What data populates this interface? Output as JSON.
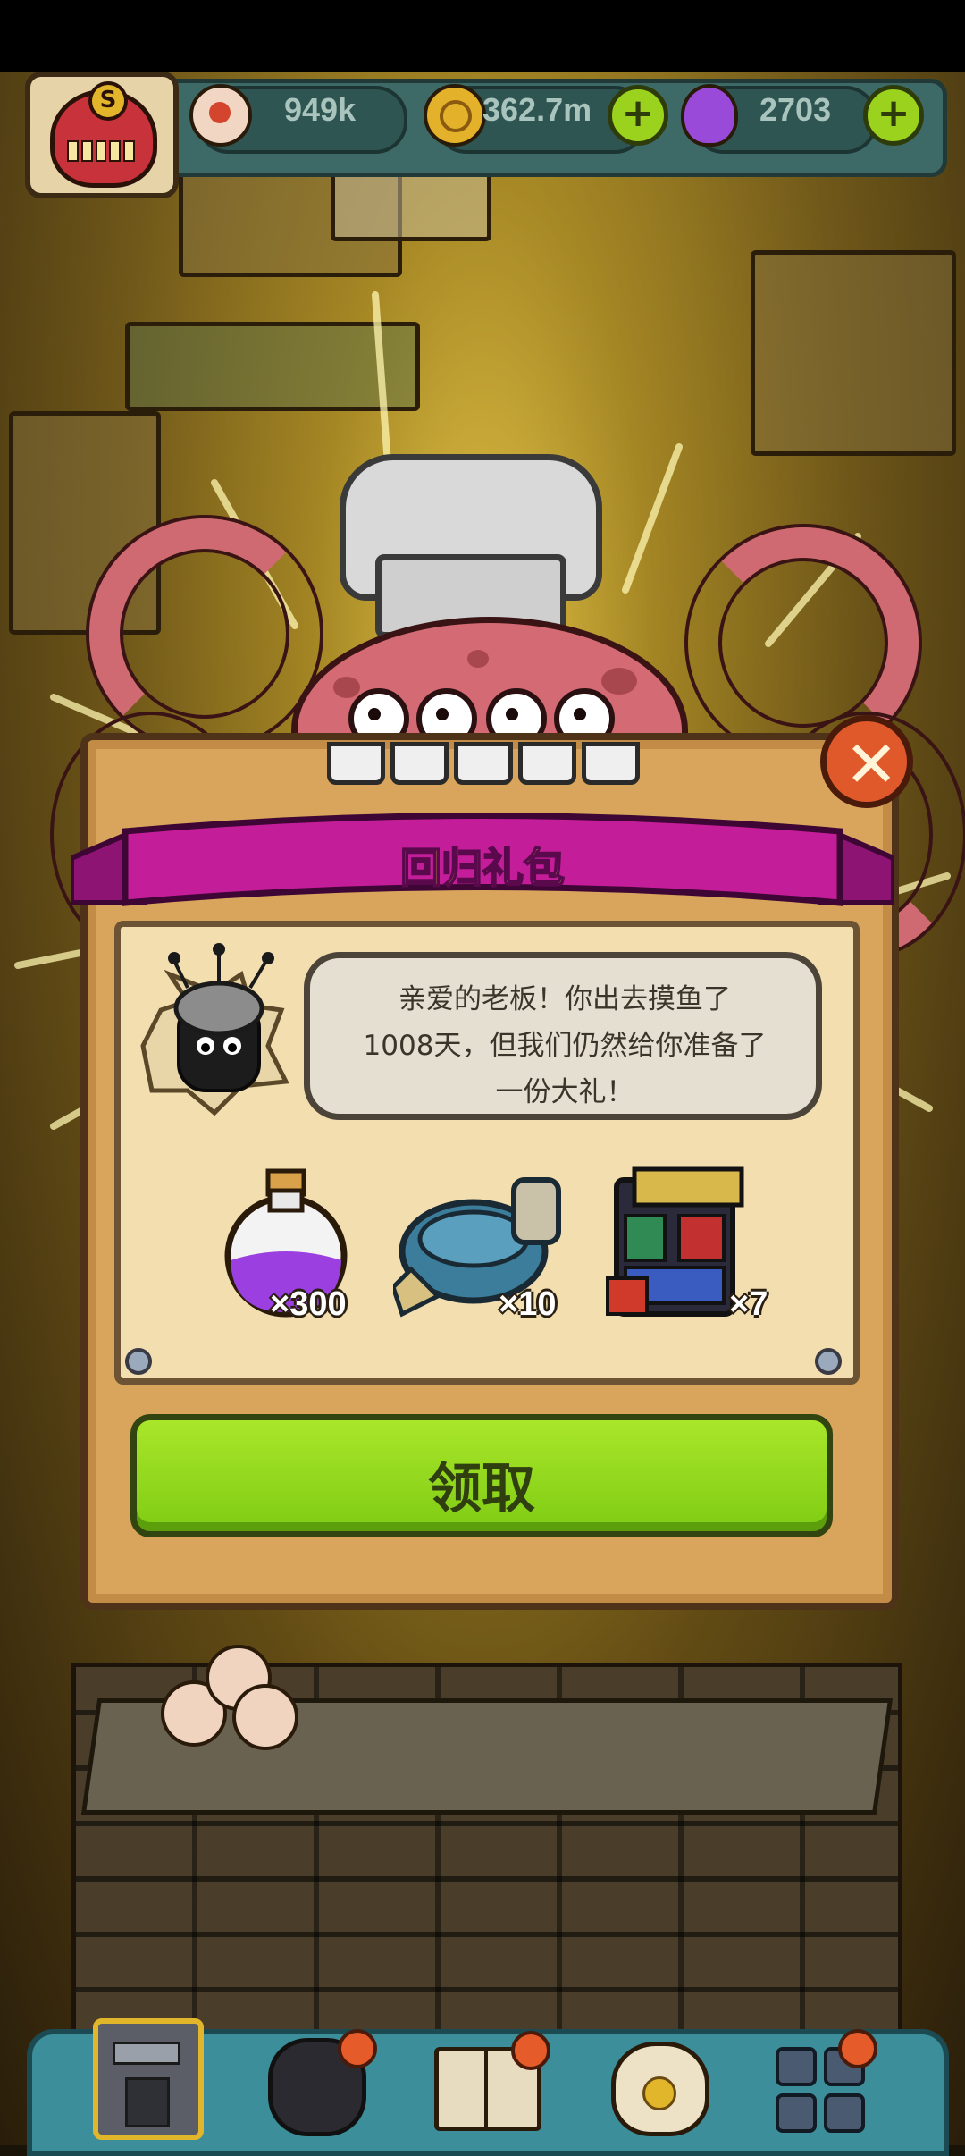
{
  "resources": {
    "eyeballs": "949k",
    "coins": "362.7m",
    "potions": "2703"
  },
  "dialog": {
    "title": "回归礼包",
    "message_line1": "亲爱的老板！你出去摸鱼了",
    "message_line2": "1008天，但我们仍然给你准备了",
    "message_line3": "一份大礼！",
    "claim_label": "领取",
    "close_symbol": "✕"
  },
  "rewards": [
    {
      "icon": "potion-bottle-icon",
      "count": "×300"
    },
    {
      "icon": "slime-cooker-icon",
      "count": "×10"
    },
    {
      "icon": "equipment-chest-icon",
      "count": "×7"
    }
  ],
  "level_badge": {
    "letter": "S"
  },
  "nav": {
    "items": [
      "kitchen-icon",
      "monster-icon",
      "recipe-book-icon",
      "money-bag-icon",
      "grid-menu-icon"
    ]
  },
  "colors": {
    "banner": "#c41d9a",
    "claim_button": "#8fd81e",
    "close_button": "#e0592a",
    "panel": "#d9a55c"
  }
}
